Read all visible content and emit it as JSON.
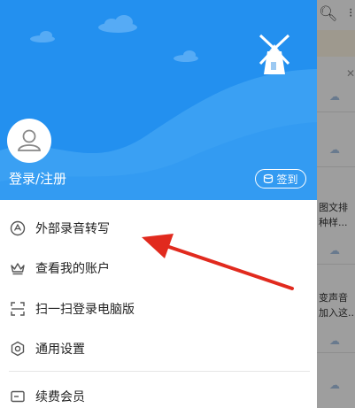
{
  "drawer": {
    "login_label": "登录/注册",
    "checkin_label": "签到",
    "menu": [
      {
        "label": "外部录音转写"
      },
      {
        "label": "查看我的账户"
      },
      {
        "label": "扫一扫登录电脑版"
      },
      {
        "label": "通用设置"
      },
      {
        "label": "续费会员"
      }
    ]
  },
  "background_app": {
    "snippet_1": "图文排",
    "snippet_2": "种样...",
    "snippet_3": "变声音",
    "snippet_4": "加入这..."
  },
  "colors": {
    "header_blue": "#2390ef",
    "wave_blue": "#3aa0f3",
    "arrow_red": "#e12a1e"
  }
}
